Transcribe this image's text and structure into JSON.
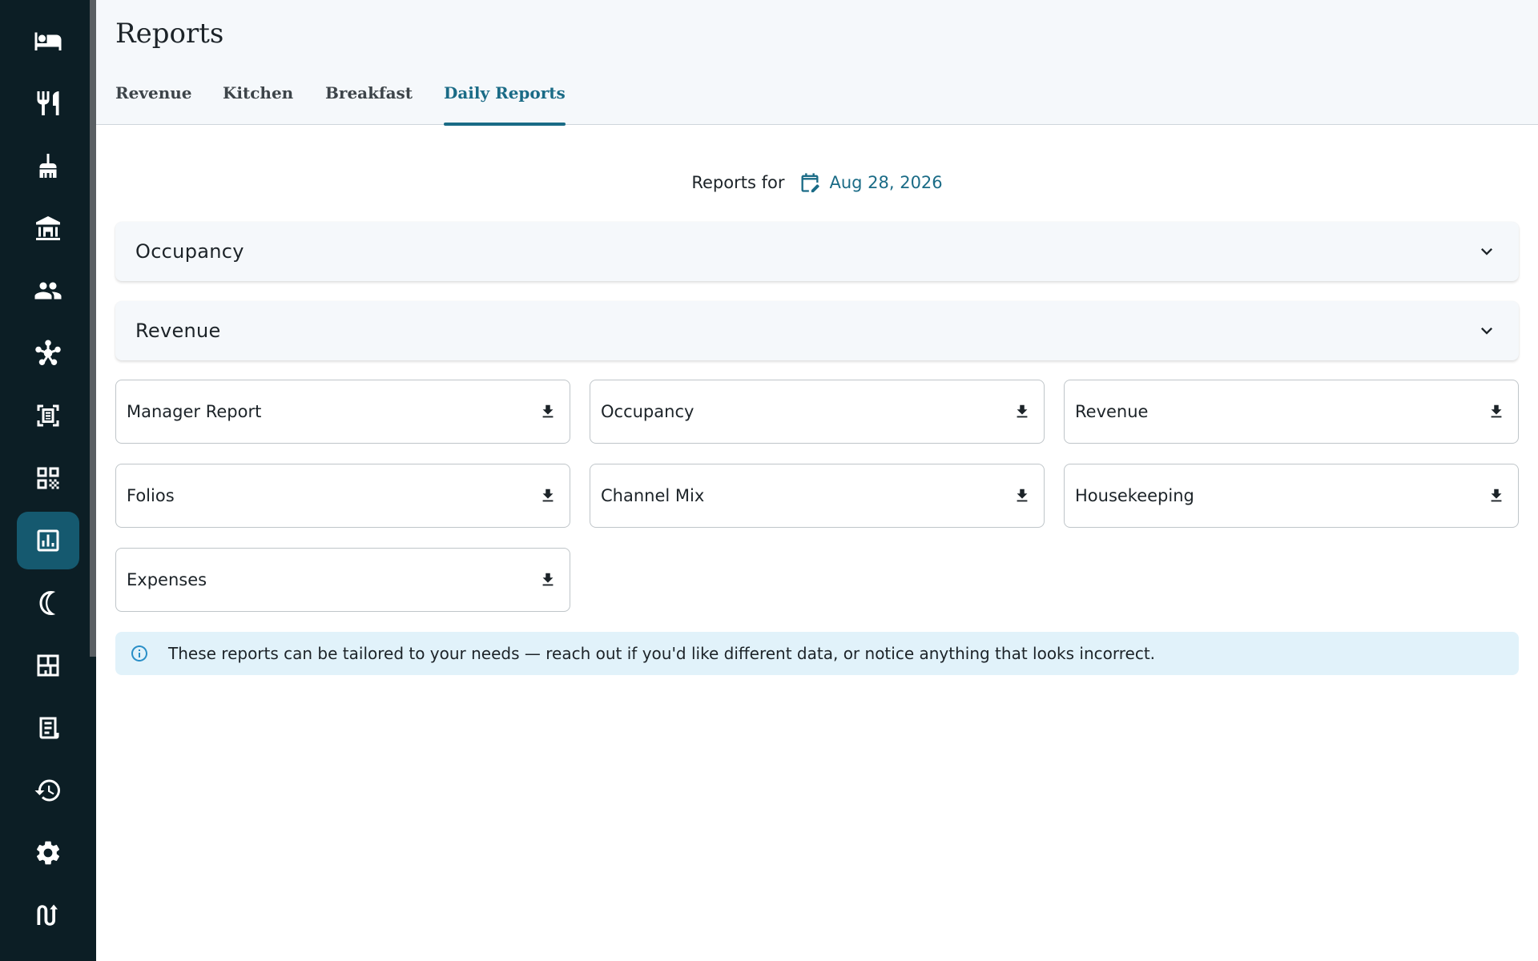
{
  "sidebar": {
    "items": [
      {
        "icon": "bed-icon",
        "active": false
      },
      {
        "icon": "restaurant-icon",
        "active": false
      },
      {
        "icon": "cleaning-icon",
        "active": false
      },
      {
        "icon": "bank-icon",
        "active": false
      },
      {
        "icon": "people-icon",
        "active": false
      },
      {
        "icon": "hub-icon",
        "active": false
      },
      {
        "icon": "scan-document-icon",
        "active": false
      },
      {
        "icon": "qr-code-icon",
        "active": false
      },
      {
        "icon": "reports-chart-icon",
        "active": true
      },
      {
        "icon": "moon-icon",
        "active": false
      },
      {
        "icon": "floor-plan-icon",
        "active": false
      },
      {
        "icon": "receipt-icon",
        "active": false
      },
      {
        "icon": "history-icon",
        "active": false
      },
      {
        "icon": "settings-gear-icon",
        "active": false
      },
      {
        "icon": "logo-icon",
        "active": false
      }
    ]
  },
  "header": {
    "title": "Reports",
    "tabs": [
      {
        "label": "Revenue",
        "active": false
      },
      {
        "label": "Kitchen",
        "active": false
      },
      {
        "label": "Breakfast",
        "active": false
      },
      {
        "label": "Daily Reports",
        "active": true
      }
    ]
  },
  "date": {
    "label": "Reports for",
    "value": "Aug 28, 2026"
  },
  "sections": [
    {
      "title": "Occupancy",
      "expanded": false
    },
    {
      "title": "Revenue",
      "expanded": false
    }
  ],
  "reports": [
    {
      "label": "Manager Report"
    },
    {
      "label": "Occupancy"
    },
    {
      "label": "Revenue"
    },
    {
      "label": "Folios"
    },
    {
      "label": "Channel Mix"
    },
    {
      "label": "Housekeeping"
    },
    {
      "label": "Expenses"
    }
  ],
  "info": {
    "text": "These reports can be tailored to your needs — reach out if you'd like different data, or notice anything that looks incorrect."
  },
  "colors": {
    "sidebar_bg": "#0c1e25",
    "active_nav": "#15596f",
    "accent": "#1a6b86",
    "info_bg": "#e1f2fa"
  }
}
